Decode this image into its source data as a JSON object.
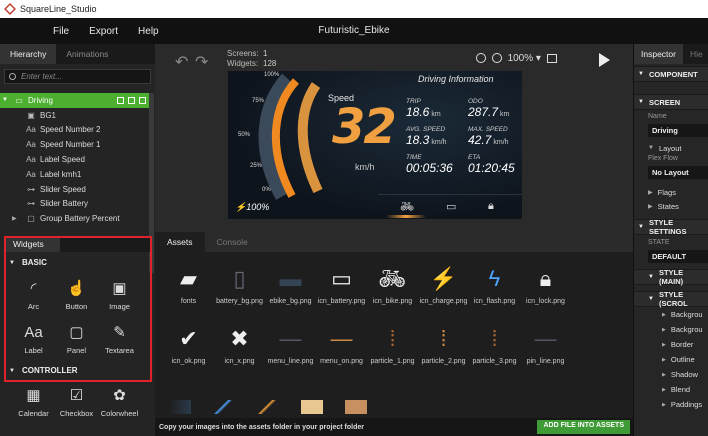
{
  "app": {
    "title": "SquareLine_Studio",
    "project_name": "Futuristic_Ebike"
  },
  "menu": {
    "file": "File",
    "export": "Export",
    "help": "Help"
  },
  "left_tabs": {
    "hierarchy": "Hierarchy",
    "animations": "Animations"
  },
  "search": {
    "placeholder": "Enter text..."
  },
  "hierarchy": {
    "items": [
      {
        "label": "Driving",
        "icon": "screen-icon"
      },
      {
        "label": "BG1",
        "icon": "image-icon"
      },
      {
        "label": "Speed Number 2",
        "icon": "label-icon"
      },
      {
        "label": "Speed Number 1",
        "icon": "label-icon"
      },
      {
        "label": "Label Speed",
        "icon": "label-icon"
      },
      {
        "label": "Label kmh1",
        "icon": "label-icon"
      },
      {
        "label": "Slider Speed",
        "icon": "slider-icon"
      },
      {
        "label": "Slider Battery",
        "icon": "slider-icon"
      },
      {
        "label": "Group Battery Percent",
        "icon": "panel-icon"
      }
    ]
  },
  "widgets": {
    "tab": "Widgets",
    "basic_title": "BASIC",
    "basic": [
      {
        "label": "Arc",
        "icon": "arc-icon"
      },
      {
        "label": "Button",
        "icon": "button-icon"
      },
      {
        "label": "Image",
        "icon": "image-icon"
      },
      {
        "label": "Label",
        "icon": "label-icon"
      },
      {
        "label": "Panel",
        "icon": "panel-icon"
      },
      {
        "label": "Textarea",
        "icon": "textarea-icon"
      }
    ],
    "controller_title": "CONTROLLER",
    "controller": [
      {
        "label": "Calendar",
        "icon": "calendar-icon"
      },
      {
        "label": "Checkbox",
        "icon": "checkbox-icon"
      },
      {
        "label": "Colorwheel",
        "icon": "colorwheel-icon"
      }
    ]
  },
  "canvas_toolbar": {
    "screens_label": "Screens:",
    "screens_value": "1",
    "widgets_label": "Widgets:",
    "widgets_value": "128",
    "zoom": "100%"
  },
  "dashboard": {
    "title": "Driving Information",
    "speed_label": "Speed",
    "speed": "32",
    "unit": "km/h",
    "gauge_marks": [
      "100%",
      "75%",
      "50%",
      "25%",
      "0%"
    ],
    "battery": "100",
    "battery_unit": "%",
    "stats": {
      "trip_label": "TRIP",
      "trip_value": "18.6",
      "trip_unit": "km",
      "odo_label": "ODO",
      "odo_value": "287.7",
      "odo_unit": "km",
      "avg_label": "AVG. SPEED",
      "avg_value": "18.3",
      "avg_unit": "km/h",
      "max_label": "MAX. SPEED",
      "max_value": "42.7",
      "max_unit": "km/h",
      "time_label": "TIME",
      "time_value": "00:05:36",
      "eta_label": "ETA",
      "eta_value": "01:20:45"
    }
  },
  "inspector": {
    "tab": "Inspector",
    "tab2": "Hie",
    "component": "COMPONENT",
    "screen": "SCREEN",
    "name_label": "Name",
    "name_value": "Driving",
    "layout": "Layout",
    "flex_flow_label": "Flex Flow",
    "flex_flow_value": "No Layout",
    "flags": "Flags",
    "states": "States",
    "style_settings": "STYLE SETTINGS",
    "state_label": "STATE",
    "state_value": "DEFAULT",
    "style_main": "STYLE (MAIN)",
    "style_scroll": "STYLE (SCROL",
    "sub": [
      "Backgrou",
      "Backgrou",
      "Border",
      "Outline",
      "Shadow",
      "Blend",
      "Paddings"
    ]
  },
  "assets": {
    "tab_assets": "Assets",
    "tab_console": "Console",
    "files": [
      {
        "name": "fonts",
        "icon": "folder-icon"
      },
      {
        "name": "battery_bg.png",
        "icon": "battery-bg-thumb"
      },
      {
        "name": "ebike_bg.png",
        "icon": "ebike-bg-thumb"
      },
      {
        "name": "icn_battery.png",
        "icon": "battery-icon"
      },
      {
        "name": "icn_bike.png",
        "icon": "bike-icon"
      },
      {
        "name": "icn_charge.png",
        "icon": "charge-icon"
      },
      {
        "name": "icn_flash.png",
        "icon": "flash-icon"
      },
      {
        "name": "icn_lock.png",
        "icon": "lock-icon"
      },
      {
        "name": "icn_ok.png",
        "icon": "check-icon"
      },
      {
        "name": "icn_x.png",
        "icon": "x-icon"
      },
      {
        "name": "menu_line.png",
        "icon": "menu-line-thumb"
      },
      {
        "name": "menu_on.png",
        "icon": "menu-on-thumb"
      },
      {
        "name": "particle_1.png",
        "icon": "particle-thumb"
      },
      {
        "name": "particle_2.png",
        "icon": "particle-thumb"
      },
      {
        "name": "particle_3.png",
        "icon": "particle-thumb"
      },
      {
        "name": "pin_line.png",
        "icon": "pin-line-thumb"
      }
    ],
    "hint": "Copy your images into the assets folder in your project folder",
    "add_button": "ADD FILE INTO ASSETS"
  },
  "colors": {
    "accent_green": "#4caf2f",
    "highlight_red": "#e0222a",
    "speed_orange": "#f0a040",
    "charge_blue": "#4ea3ff"
  }
}
